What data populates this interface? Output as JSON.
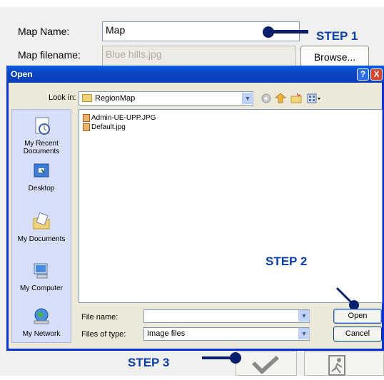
{
  "form": {
    "map_name_label": "Map Name:",
    "map_name_value": "Map",
    "map_filename_label": "Map filename:",
    "map_filename_value": "Blue hills.jpg",
    "browse_label": "Browse..."
  },
  "steps": {
    "step1": "STEP 1",
    "step2": "STEP 2",
    "step3": "STEP 3"
  },
  "dialog": {
    "title": "Open",
    "help_btn": "?",
    "close_btn": "X",
    "look_in_label": "Look in:",
    "look_in_value": "RegionMap",
    "places": [
      {
        "label": "My Recent\nDocuments"
      },
      {
        "label": "Desktop"
      },
      {
        "label": "My Documents"
      },
      {
        "label": "My Computer"
      },
      {
        "label": "My Network"
      }
    ],
    "files": [
      {
        "name": "Admin-UE-UPP.JPG"
      },
      {
        "name": "Default.jpg"
      }
    ],
    "file_name_label": "File name:",
    "file_name_value": "",
    "file_type_label": "Files of type:",
    "file_type_value": "Image files",
    "open_btn": "Open",
    "cancel_btn": "Cancel"
  },
  "colors": {
    "step_text": "#0a3dac",
    "arrow": "#0a1f6c",
    "titlebar": "#0b45c4"
  }
}
